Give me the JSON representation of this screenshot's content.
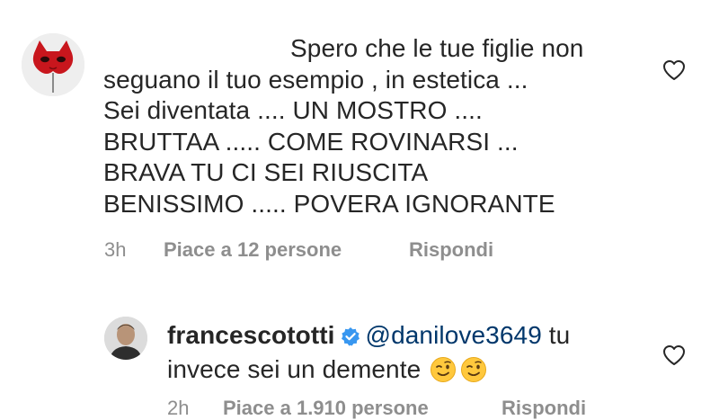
{
  "comments": [
    {
      "text_lines": [
        "Spero che le tue figlie non",
        "seguano il tuo esempio , in estetica ...",
        "Sei diventata .... UN MOSTRO ....",
        "BRUTTAA ..... COME ROVINARSI ...",
        "BRAVA TU CI SEI RIUSCITA",
        "BENISSIMO ..... POVERA IGNORANTE"
      ],
      "timestamp": "3h",
      "likes_label": "Piace a 12 persone",
      "reply_label": "Rispondi",
      "avatar_icon": "red-cat-mask-icon"
    },
    {
      "username": "francescototti",
      "mention": "@danilove3649",
      "text_after_mention": " tu",
      "text_line2": "invece sei un demente",
      "emojis": [
        "winking-face-emoji",
        "winking-face-emoji"
      ],
      "timestamp": "2h",
      "likes_label": "Piace a 1.910 persone",
      "reply_label": "Rispondi",
      "avatar_icon": "profile-photo"
    }
  ],
  "colors": {
    "text": "#262626",
    "meta": "#8e8e8e",
    "mention": "#00376b",
    "verified": "#3897f0",
    "mask_red": "#c8161d"
  }
}
